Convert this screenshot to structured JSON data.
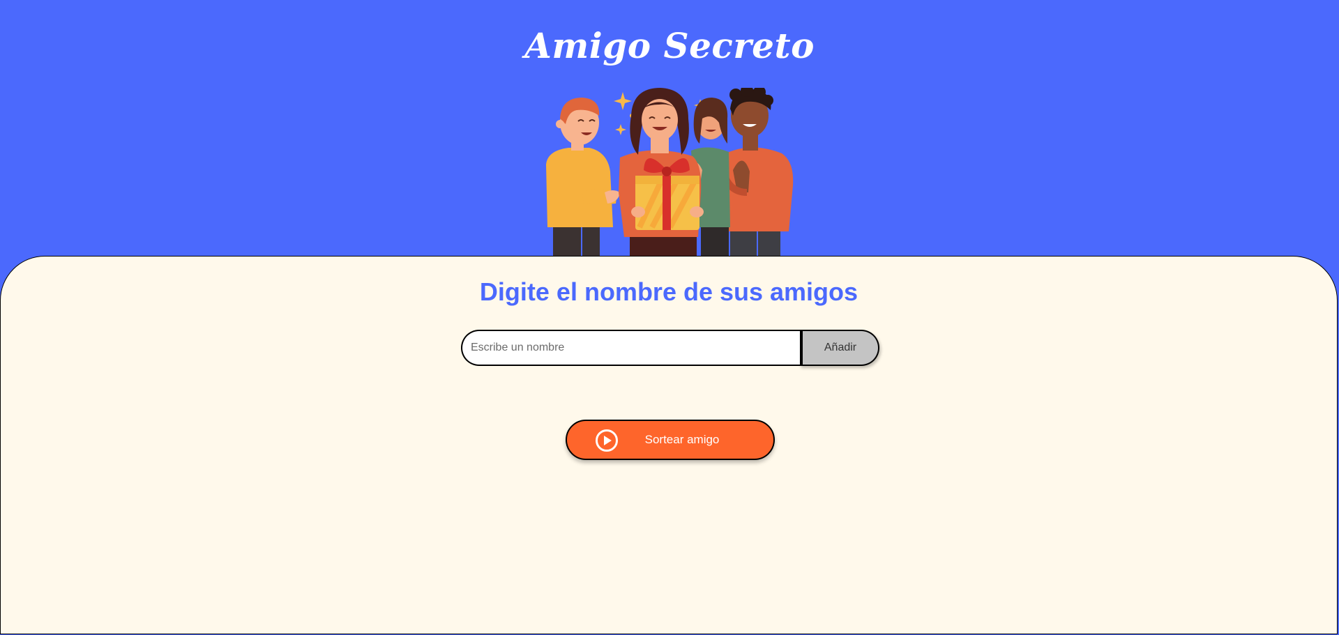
{
  "header": {
    "title": "Amigo Secreto",
    "background_color": "#4B69FD",
    "illustration": "friends-with-gift-illustration"
  },
  "main": {
    "background_color": "#FFF9EB",
    "section_title": "Digite el nombre de sus amigos",
    "name_input": {
      "value": "",
      "placeholder": "Escribe un nombre"
    },
    "add_button_label": "Añadir",
    "draw_button": {
      "label": "Sortear amigo",
      "icon": "play-circle-icon",
      "color": "#FE652B"
    },
    "friends_list": [],
    "result": ""
  }
}
